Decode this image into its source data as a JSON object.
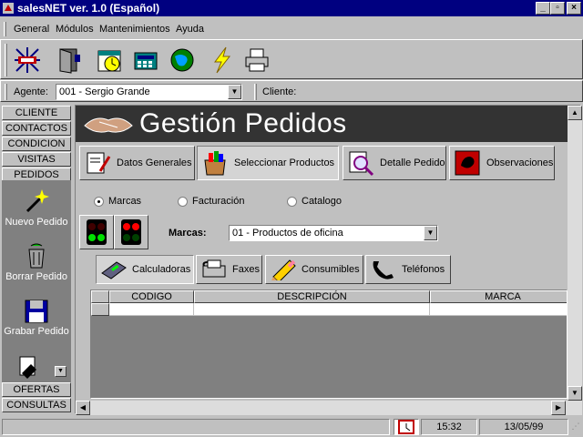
{
  "window": {
    "title": "salesNET ver. 1.0 (Español)",
    "controls": {
      "minimize": "_",
      "maximize": "▫",
      "close": "×"
    }
  },
  "menu": {
    "items": [
      {
        "label": "General",
        "accel": "G"
      },
      {
        "label": "Módulos",
        "accel": "M"
      },
      {
        "label": "Mantenimientos",
        "accel": "M"
      },
      {
        "label": "Ayuda",
        "accel": "A"
      }
    ]
  },
  "agentbar": {
    "agent_label": "Agente:",
    "agent_value": "001 - Sergio Grande",
    "client_label": "Cliente:"
  },
  "sidebar": {
    "top_items": [
      "CLIENTE",
      "CONTACTOS",
      "CONDICION",
      "VISITAS",
      "PEDIDOS"
    ],
    "actions": [
      "Nuevo Pedido",
      "Borrar Pedido",
      "Grabar Pedido"
    ],
    "bottom_items": [
      "OFERTAS",
      "CONSULTAS"
    ]
  },
  "main": {
    "title": "Gestión Pedidos",
    "tabs": [
      {
        "label": "Datos Generales",
        "selected": false
      },
      {
        "label": "Seleccionar Productos",
        "selected": true
      },
      {
        "label": "Detalle Pedido",
        "selected": false
      },
      {
        "label": "Observaciones",
        "selected": false
      }
    ],
    "radios": [
      {
        "label": "Marcas",
        "checked": true
      },
      {
        "label": "Facturación",
        "checked": false
      },
      {
        "label": "Catalogo",
        "checked": false
      }
    ],
    "marcas_label": "Marcas:",
    "marcas_value": "01 - Productos de oficina",
    "subtabs": [
      {
        "label": "Calculadoras",
        "selected": true
      },
      {
        "label": "Faxes",
        "selected": false
      },
      {
        "label": "Consumibles",
        "selected": false
      },
      {
        "label": "Teléfonos",
        "selected": false
      }
    ],
    "grid_columns": [
      "CODIGO",
      "DESCRIPCIÓN",
      "MARCA"
    ]
  },
  "status": {
    "time": "15:32",
    "date": "13/05/99"
  },
  "colors": {
    "titlebar": "#000080",
    "face": "#c0c0c0",
    "header": "#333333"
  }
}
